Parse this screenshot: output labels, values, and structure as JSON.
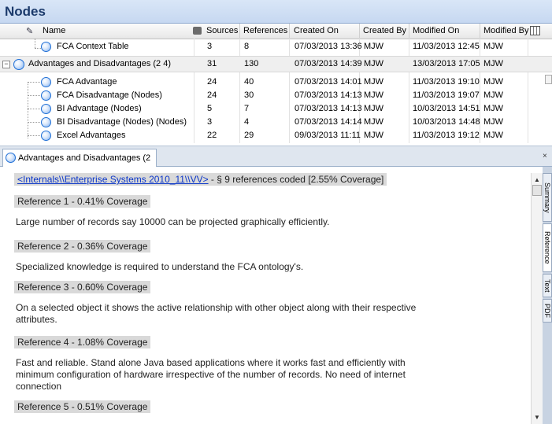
{
  "panel": {
    "title": "Nodes"
  },
  "grid": {
    "columns": [
      "Name",
      "Sources",
      "References",
      "Created On",
      "Created By",
      "Modified On",
      "Modified By"
    ],
    "rows_top": [
      {
        "name": "FCA Context Table",
        "sources": "3",
        "references": "8",
        "created_on": "07/03/2013 13:36",
        "created_by": "MJW",
        "modified_on": "11/03/2013 12:45",
        "modified_by": "MJW"
      }
    ],
    "group": {
      "name": "Advantages and Disadvantages (2 4)",
      "sources": "31",
      "references": "130",
      "created_on": "07/03/2013 14:39",
      "created_by": "MJW",
      "modified_on": "13/03/2013 17:05",
      "modified_by": "MJW",
      "expander": "−"
    },
    "rows_children": [
      {
        "name": "FCA Advantage",
        "sources": "24",
        "references": "40",
        "created_on": "07/03/2013 14:01",
        "created_by": "MJW",
        "modified_on": "11/03/2013 19:10",
        "modified_by": "MJW"
      },
      {
        "name": "FCA Disadvantage (Nodes)",
        "sources": "24",
        "references": "30",
        "created_on": "07/03/2013 14:13",
        "created_by": "MJW",
        "modified_on": "11/03/2013 19:07",
        "modified_by": "MJW"
      },
      {
        "name": "BI Advantage (Nodes)",
        "sources": "5",
        "references": "7",
        "created_on": "07/03/2013 14:13",
        "created_by": "MJW",
        "modified_on": "10/03/2013 14:51",
        "modified_by": "MJW"
      },
      {
        "name": "BI Disadvantage (Nodes) (Nodes)",
        "sources": "3",
        "references": "4",
        "created_on": "07/03/2013 14:14",
        "created_by": "MJW",
        "modified_on": "10/03/2013 14:48",
        "modified_by": "MJW"
      },
      {
        "name": "Excel Advantages",
        "sources": "22",
        "references": "29",
        "created_on": "09/03/2013 11:11",
        "created_by": "MJW",
        "modified_on": "11/03/2013 19:12",
        "modified_by": "MJW"
      }
    ]
  },
  "detail": {
    "tab_label": "Advantages and Disadvantages (2",
    "tab_close": "×",
    "source_link": "<Internals\\\\Enterprise Systems 2010_11\\\\VV>",
    "source_summary": " - § 9 references coded  [2.55% Coverage]",
    "references": [
      {
        "header": "Reference 1 - 0.41% Coverage",
        "text": "Large number of records say 10000 can be projected graphically efficiently."
      },
      {
        "header": "Reference 2 - 0.36% Coverage",
        "text": "Specialized knowledge is required to understand the FCA ontology's."
      },
      {
        "header": "Reference 3 - 0.60% Coverage",
        "text": "On a selected object it shows the active relationship with other object along with their respective attributes."
      },
      {
        "header": "Reference 4 - 1.08% Coverage",
        "text": "Fast and reliable. Stand alone Java based applications where it works fast and efficiently with minimum configuration of hardware irrespective of the number of records. No need of internet connection"
      },
      {
        "header": "Reference 5 - 0.51% Coverage",
        "text": ""
      }
    ]
  },
  "side_tabs": [
    "Summary",
    "Reference",
    "Text",
    "PDF"
  ],
  "icons": {
    "node": "node-ball-icon",
    "sources_header": "sources-icon",
    "name_header": "pin-icon",
    "column_chooser": "column-chooser-icon",
    "scroll_up": "▲",
    "scroll_down": "▼"
  },
  "colors": {
    "header_bg": "#c6d8f1",
    "node_blue": "#1f6fd6",
    "link": "#0b36c8",
    "ref_bg": "#d9d9d9"
  }
}
